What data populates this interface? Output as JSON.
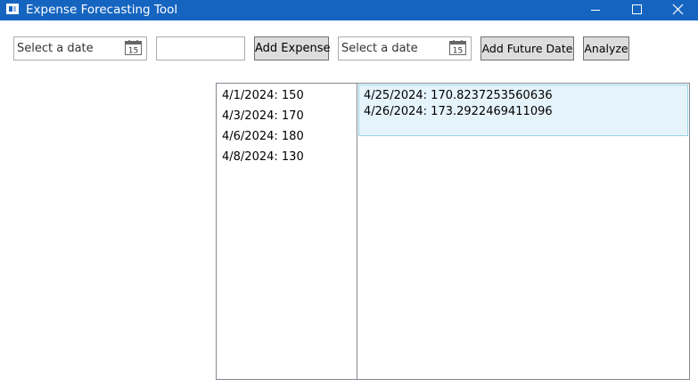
{
  "window": {
    "title": "Expense Forecasting Tool"
  },
  "toolbar": {
    "expense_date_placeholder": "Select a date",
    "calendar_icon_text": "15",
    "amount_value": "",
    "add_expense_label": "Add Expense",
    "future_date_placeholder": "Select a date",
    "add_future_date_label": "Add Future Date",
    "analyze_label": "Analyze"
  },
  "expenses": [
    "4/1/2024: 150",
    "4/3/2024: 170",
    "4/6/2024: 180",
    "4/8/2024: 130"
  ],
  "forecasts": {
    "selected_index": 0,
    "lines": [
      "4/25/2024: 170.8237253560636",
      "4/26/2024: 173.2922469411096"
    ]
  },
  "colors": {
    "titlebar": "#1565c0",
    "selection_background": "#e5f3fb",
    "selection_border": "#9bd3e6",
    "button_background": "#dddddd"
  },
  "icons": [
    "app-icon",
    "minimize-icon",
    "maximize-icon",
    "close-icon",
    "calendar-icon"
  ]
}
